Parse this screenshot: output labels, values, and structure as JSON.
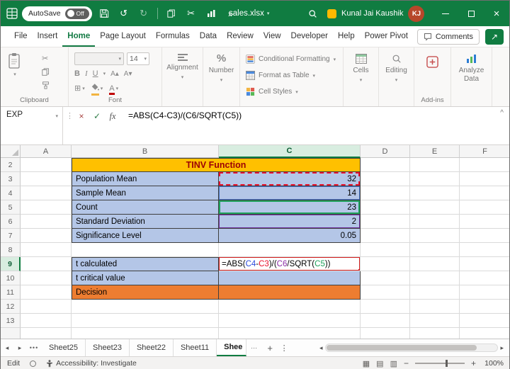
{
  "titlebar": {
    "autosave_label": "AutoSave",
    "autosave_state": "Off",
    "filename": "sales.xlsx",
    "user_name": "Kunal Jai Kaushik",
    "avatar_initials": "KJ"
  },
  "menubar": {
    "tabs": [
      "File",
      "Insert",
      "Home",
      "Page Layout",
      "Formulas",
      "Data",
      "Review",
      "View",
      "Developer",
      "Help",
      "Power Pivot"
    ],
    "active_tab": "Home",
    "comments_label": "Comments"
  },
  "ribbon": {
    "clipboard_group_label": "Clipboard",
    "font_group_label": "Font",
    "font_size": "14",
    "bold_label": "B",
    "italic_label": "I",
    "underline_label": "U",
    "alignment_label": "Alignment",
    "number_label": "Number",
    "percent_label": "%",
    "conditional_formatting_label": "Conditional Formatting",
    "format_as_table_label": "Format as Table",
    "cell_styles_label": "Cell Styles",
    "cells_label": "Cells",
    "editing_label": "Editing",
    "addins_group_label": "Add-ins",
    "analyze_data_label": "Analyze Data"
  },
  "formula_bar": {
    "name_box": "EXP",
    "fx_label": "fx",
    "formula": "=ABS(C4-C3)/(C6/SQRT(C5))"
  },
  "grid": {
    "column_headers": [
      "A",
      "B",
      "C",
      "D",
      "E",
      "F"
    ],
    "active_column": "C",
    "active_row": "9",
    "row_numbers": [
      "2",
      "3",
      "4",
      "5",
      "6",
      "7",
      "8",
      "9",
      "10",
      "11",
      "12",
      "13"
    ],
    "title_cell": "TINV Function",
    "data_rows": [
      {
        "row": "3",
        "label": "Population Mean",
        "value": "32",
        "ref_border": "red-dashed"
      },
      {
        "row": "4",
        "label": "Sample Mean",
        "value": "14",
        "ref_border": "blue"
      },
      {
        "row": "5",
        "label": "Count",
        "value": "23",
        "ref_border": "green"
      },
      {
        "row": "6",
        "label": "Standard Deviation",
        "value": "2",
        "ref_border": "purple"
      },
      {
        "row": "7",
        "label": "Significance Level",
        "value": "0.05",
        "ref_border": "none"
      }
    ],
    "calc_rows": [
      {
        "row": "9",
        "label": "t calculated"
      },
      {
        "row": "10",
        "label": "t critical value"
      },
      {
        "row": "11",
        "label": "Decision"
      }
    ],
    "formula_segments": [
      {
        "text": "=ABS(",
        "color": "#000000"
      },
      {
        "text": "C4",
        "color": "#2b4bdd"
      },
      {
        "text": "-",
        "color": "#000000"
      },
      {
        "text": "C3",
        "color": "#e8112d"
      },
      {
        "text": ")/(",
        "color": "#000000"
      },
      {
        "text": "C6",
        "color": "#8a2ca5"
      },
      {
        "text": "/SQRT(",
        "color": "#000000"
      },
      {
        "text": "C5",
        "color": "#1fa25d"
      },
      {
        "text": "))",
        "color": "#000000"
      }
    ]
  },
  "sheet_tabs": {
    "sheets": [
      "Sheet25",
      "Sheet23",
      "Sheet22",
      "Sheet11"
    ],
    "active_sheet": "Shee",
    "more_left": "•••",
    "more_right": "⋯"
  },
  "statusbar": {
    "mode": "Edit",
    "accessibility_label": "Accessibility: Investigate",
    "zoom": "100%"
  },
  "colors": {
    "titlebar_green": "#107c41",
    "header_gold": "#ffc000",
    "title_text": "#9c0006",
    "row_blue": "#b4c6e7",
    "row_orange": "#ed7d31",
    "active_cell_border": "#d21c1c"
  }
}
